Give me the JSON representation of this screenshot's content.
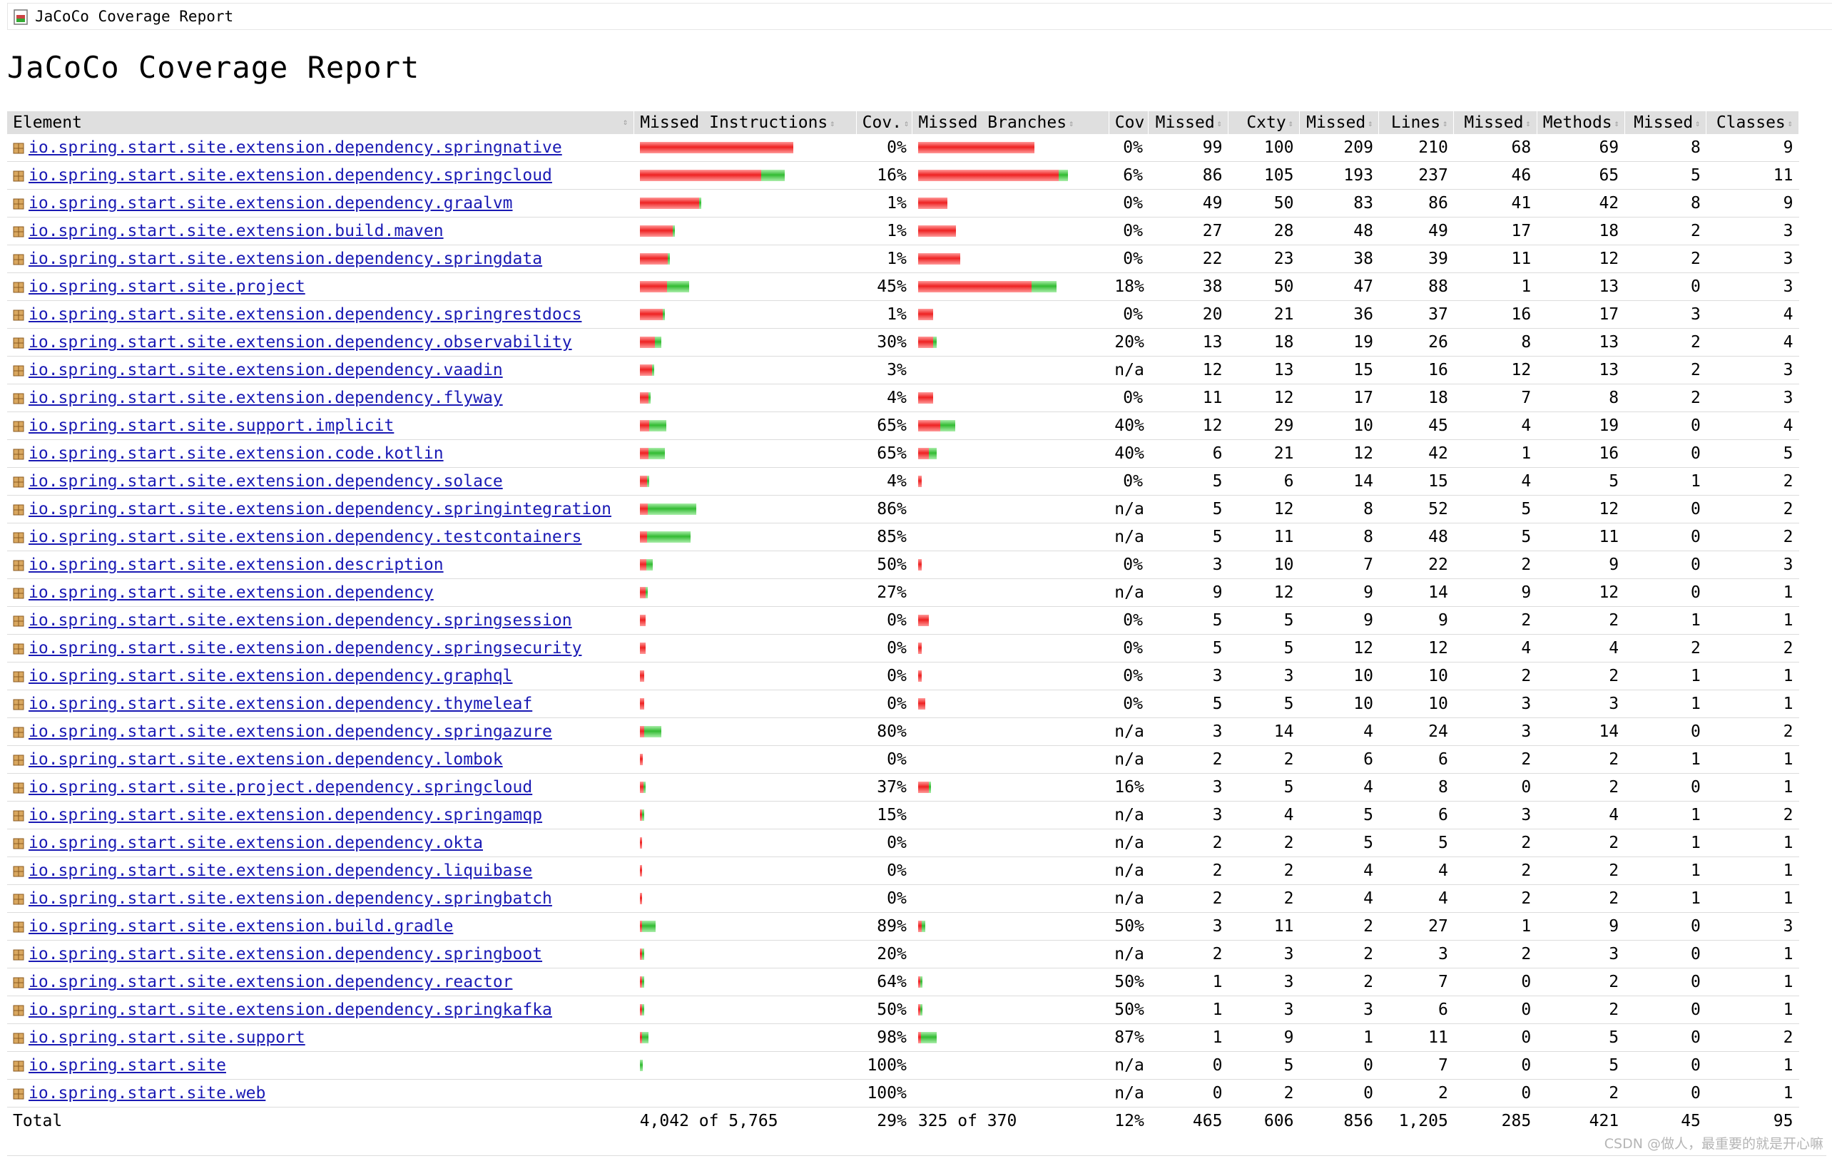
{
  "breadcrumb": {
    "label": "JaCoCo Coverage Report"
  },
  "page_title": "JaCoCo Coverage Report",
  "columns": {
    "element": "Element",
    "missed_instructions": "Missed Instructions",
    "cov1": "Cov.",
    "missed_branches": "Missed Branches",
    "cov2": "Cov.",
    "missed_cxty": "Missed",
    "cxty": "Cxty",
    "missed_lines": "Missed",
    "lines": "Lines",
    "missed_methods": "Missed",
    "methods": "Methods",
    "missed_classes": "Missed",
    "classes": "Classes"
  },
  "rows": [
    {
      "name": "io.spring.start.site.extension.dependency.springnative",
      "instr_missed": 430,
      "instr_covered": 0,
      "instr_cov": "0%",
      "br_missed": 220,
      "br_covered": 0,
      "br_cov": "0%",
      "mcx": "99",
      "cx": "100",
      "ml": "209",
      "l": "210",
      "mm": "68",
      "m": "69",
      "mc": "8",
      "c": "9"
    },
    {
      "name": "io.spring.start.site.extension.dependency.springcloud",
      "instr_missed": 341,
      "instr_covered": 65,
      "instr_cov": "16%",
      "br_missed": 267,
      "br_covered": 17,
      "br_cov": "6%",
      "mcx": "86",
      "cx": "105",
      "ml": "193",
      "l": "237",
      "mm": "46",
      "m": "65",
      "mc": "5",
      "c": "11"
    },
    {
      "name": "io.spring.start.site.extension.dependency.graalvm",
      "instr_missed": 167,
      "instr_covered": 2,
      "instr_cov": "1%",
      "br_missed": 56,
      "br_covered": 0,
      "br_cov": "0%",
      "mcx": "49",
      "cx": "50",
      "ml": "83",
      "l": "86",
      "mm": "41",
      "m": "42",
      "mc": "8",
      "c": "9"
    },
    {
      "name": "io.spring.start.site.extension.build.maven",
      "instr_missed": 92,
      "instr_covered": 1,
      "instr_cov": "1%",
      "br_missed": 72,
      "br_covered": 0,
      "br_cov": "0%",
      "mcx": "27",
      "cx": "28",
      "ml": "48",
      "l": "49",
      "mm": "17",
      "m": "18",
      "mc": "2",
      "c": "3"
    },
    {
      "name": "io.spring.start.site.extension.dependency.springdata",
      "instr_missed": 79,
      "instr_covered": 1,
      "instr_cov": "1%",
      "br_missed": 80,
      "br_covered": 0,
      "br_cov": "0%",
      "mcx": "22",
      "cx": "23",
      "ml": "38",
      "l": "39",
      "mm": "11",
      "m": "12",
      "mc": "2",
      "c": "3"
    },
    {
      "name": "io.spring.start.site.project",
      "instr_missed": 76,
      "instr_covered": 62,
      "instr_cov": "45%",
      "br_missed": 215,
      "br_covered": 48,
      "br_cov": "18%",
      "mcx": "38",
      "cx": "50",
      "ml": "47",
      "l": "88",
      "mm": "1",
      "m": "13",
      "mc": "0",
      "c": "3"
    },
    {
      "name": "io.spring.start.site.extension.dependency.springrestdocs",
      "instr_missed": 65,
      "instr_covered": 1,
      "instr_cov": "1%",
      "br_missed": 28,
      "br_covered": 0,
      "br_cov": "0%",
      "mcx": "20",
      "cx": "21",
      "ml": "36",
      "l": "37",
      "mm": "16",
      "m": "17",
      "mc": "3",
      "c": "4"
    },
    {
      "name": "io.spring.start.site.extension.dependency.observability",
      "instr_missed": 42,
      "instr_covered": 18,
      "instr_cov": "30%",
      "br_missed": 28,
      "br_covered": 7,
      "br_cov": "20%",
      "mcx": "13",
      "cx": "18",
      "ml": "19",
      "l": "26",
      "mm": "8",
      "m": "13",
      "mc": "2",
      "c": "4"
    },
    {
      "name": "io.spring.start.site.extension.dependency.vaadin",
      "instr_missed": 34,
      "instr_covered": 1,
      "instr_cov": "3%",
      "br_missed": 0,
      "br_covered": 0,
      "br_cov": "n/a",
      "mcx": "12",
      "cx": "13",
      "ml": "15",
      "l": "16",
      "mm": "12",
      "m": "13",
      "mc": "2",
      "c": "3"
    },
    {
      "name": "io.spring.start.site.extension.dependency.flyway",
      "instr_missed": 25,
      "instr_covered": 1,
      "instr_cov": "4%",
      "br_missed": 28,
      "br_covered": 0,
      "br_cov": "0%",
      "mcx": "11",
      "cx": "12",
      "ml": "17",
      "l": "18",
      "mm": "7",
      "m": "8",
      "mc": "2",
      "c": "3"
    },
    {
      "name": "io.spring.start.site.support.implicit",
      "instr_missed": 26,
      "instr_covered": 48,
      "instr_cov": "65%",
      "br_missed": 42,
      "br_covered": 28,
      "br_cov": "40%",
      "mcx": "12",
      "cx": "29",
      "ml": "10",
      "l": "45",
      "mm": "4",
      "m": "19",
      "mc": "0",
      "c": "4"
    },
    {
      "name": "io.spring.start.site.extension.code.kotlin",
      "instr_missed": 25,
      "instr_covered": 46,
      "instr_cov": "65%",
      "br_missed": 21,
      "br_covered": 14,
      "br_cov": "40%",
      "mcx": "6",
      "cx": "21",
      "ml": "12",
      "l": "42",
      "mm": "1",
      "m": "16",
      "mc": "0",
      "c": "5"
    },
    {
      "name": "io.spring.start.site.extension.dependency.solace",
      "instr_missed": 21,
      "instr_covered": 1,
      "instr_cov": "4%",
      "br_missed": 7,
      "br_covered": 0,
      "br_cov": "0%",
      "mcx": "5",
      "cx": "6",
      "ml": "14",
      "l": "15",
      "mm": "4",
      "m": "5",
      "mc": "1",
      "c": "2"
    },
    {
      "name": "io.spring.start.site.extension.dependency.springintegration",
      "instr_missed": 22,
      "instr_covered": 136,
      "instr_cov": "86%",
      "br_missed": 0,
      "br_covered": 0,
      "br_cov": "n/a",
      "mcx": "5",
      "cx": "12",
      "ml": "8",
      "l": "52",
      "mm": "5",
      "m": "12",
      "mc": "0",
      "c": "2"
    },
    {
      "name": "io.spring.start.site.extension.dependency.testcontainers",
      "instr_missed": 21,
      "instr_covered": 122,
      "instr_cov": "85%",
      "br_missed": 0,
      "br_covered": 0,
      "br_cov": "n/a",
      "mcx": "5",
      "cx": "11",
      "ml": "8",
      "l": "48",
      "mm": "5",
      "m": "11",
      "mc": "0",
      "c": "2"
    },
    {
      "name": "io.spring.start.site.extension.description",
      "instr_missed": 18,
      "instr_covered": 18,
      "instr_cov": "50%",
      "br_missed": 7,
      "br_covered": 0,
      "br_cov": "0%",
      "mcx": "3",
      "cx": "10",
      "ml": "7",
      "l": "22",
      "mm": "2",
      "m": "9",
      "mc": "0",
      "c": "3"
    },
    {
      "name": "io.spring.start.site.extension.dependency",
      "instr_missed": 16,
      "instr_covered": 6,
      "instr_cov": "27%",
      "br_missed": 0,
      "br_covered": 0,
      "br_cov": "n/a",
      "mcx": "9",
      "cx": "12",
      "ml": "9",
      "l": "14",
      "mm": "9",
      "m": "12",
      "mc": "0",
      "c": "1"
    },
    {
      "name": "io.spring.start.site.extension.dependency.springsession",
      "instr_missed": 16,
      "instr_covered": 0,
      "instr_cov": "0%",
      "br_missed": 21,
      "br_covered": 0,
      "br_cov": "0%",
      "mcx": "5",
      "cx": "5",
      "ml": "9",
      "l": "9",
      "mm": "2",
      "m": "2",
      "mc": "1",
      "c": "1"
    },
    {
      "name": "io.spring.start.site.extension.dependency.springsecurity",
      "instr_missed": 16,
      "instr_covered": 0,
      "instr_cov": "0%",
      "br_missed": 7,
      "br_covered": 0,
      "br_cov": "0%",
      "mcx": "5",
      "cx": "5",
      "ml": "12",
      "l": "12",
      "mm": "4",
      "m": "4",
      "mc": "2",
      "c": "2"
    },
    {
      "name": "io.spring.start.site.extension.dependency.graphql",
      "instr_missed": 12,
      "instr_covered": 0,
      "instr_cov": "0%",
      "br_missed": 7,
      "br_covered": 0,
      "br_cov": "0%",
      "mcx": "3",
      "cx": "3",
      "ml": "10",
      "l": "10",
      "mm": "2",
      "m": "2",
      "mc": "1",
      "c": "1"
    },
    {
      "name": "io.spring.start.site.extension.dependency.thymeleaf",
      "instr_missed": 12,
      "instr_covered": 0,
      "instr_cov": "0%",
      "br_missed": 14,
      "br_covered": 0,
      "br_cov": "0%",
      "mcx": "5",
      "cx": "5",
      "ml": "10",
      "l": "10",
      "mm": "3",
      "m": "3",
      "mc": "1",
      "c": "1"
    },
    {
      "name": "io.spring.start.site.extension.dependency.springazure",
      "instr_missed": 12,
      "instr_covered": 48,
      "instr_cov": "80%",
      "br_missed": 0,
      "br_covered": 0,
      "br_cov": "n/a",
      "mcx": "3",
      "cx": "14",
      "ml": "4",
      "l": "24",
      "mm": "3",
      "m": "14",
      "mc": "0",
      "c": "2"
    },
    {
      "name": "io.spring.start.site.extension.dependency.lombok",
      "instr_missed": 8,
      "instr_covered": 0,
      "instr_cov": "0%",
      "br_missed": 0,
      "br_covered": 0,
      "br_cov": "n/a",
      "mcx": "2",
      "cx": "2",
      "ml": "6",
      "l": "6",
      "mm": "2",
      "m": "2",
      "mc": "1",
      "c": "1"
    },
    {
      "name": "io.spring.start.site.project.dependency.springcloud",
      "instr_missed": 10,
      "instr_covered": 6,
      "instr_cov": "37%",
      "br_missed": 21,
      "br_covered": 4,
      "br_cov": "16%",
      "mcx": "3",
      "cx": "5",
      "ml": "4",
      "l": "8",
      "mm": "0",
      "m": "2",
      "mc": "0",
      "c": "1"
    },
    {
      "name": "io.spring.start.site.extension.dependency.springamqp",
      "instr_missed": 7,
      "instr_covered": 1,
      "instr_cov": "15%",
      "br_missed": 0,
      "br_covered": 0,
      "br_cov": "n/a",
      "mcx": "3",
      "cx": "4",
      "ml": "5",
      "l": "6",
      "mm": "3",
      "m": "4",
      "mc": "1",
      "c": "2"
    },
    {
      "name": "io.spring.start.site.extension.dependency.okta",
      "instr_missed": 7,
      "instr_covered": 0,
      "instr_cov": "0%",
      "br_missed": 0,
      "br_covered": 0,
      "br_cov": "n/a",
      "mcx": "2",
      "cx": "2",
      "ml": "5",
      "l": "5",
      "mm": "2",
      "m": "2",
      "mc": "1",
      "c": "1"
    },
    {
      "name": "io.spring.start.site.extension.dependency.liquibase",
      "instr_missed": 7,
      "instr_covered": 0,
      "instr_cov": "0%",
      "br_missed": 0,
      "br_covered": 0,
      "br_cov": "n/a",
      "mcx": "2",
      "cx": "2",
      "ml": "4",
      "l": "4",
      "mm": "2",
      "m": "2",
      "mc": "1",
      "c": "1"
    },
    {
      "name": "io.spring.start.site.extension.dependency.springbatch",
      "instr_missed": 7,
      "instr_covered": 0,
      "instr_cov": "0%",
      "br_missed": 0,
      "br_covered": 0,
      "br_cov": "n/a",
      "mcx": "2",
      "cx": "2",
      "ml": "4",
      "l": "4",
      "mm": "2",
      "m": "2",
      "mc": "1",
      "c": "1"
    },
    {
      "name": "io.spring.start.site.extension.build.gradle",
      "instr_missed": 5,
      "instr_covered": 38,
      "instr_cov": "89%",
      "br_missed": 7,
      "br_covered": 7,
      "br_cov": "50%",
      "mcx": "3",
      "cx": "11",
      "ml": "2",
      "l": "27",
      "mm": "1",
      "m": "9",
      "mc": "0",
      "c": "3"
    },
    {
      "name": "io.spring.start.site.extension.dependency.springboot",
      "instr_missed": 6,
      "instr_covered": 1,
      "instr_cov": "20%",
      "br_missed": 0,
      "br_covered": 0,
      "br_cov": "n/a",
      "mcx": "2",
      "cx": "3",
      "ml": "2",
      "l": "3",
      "mm": "2",
      "m": "3",
      "mc": "0",
      "c": "1"
    },
    {
      "name": "io.spring.start.site.extension.dependency.reactor",
      "instr_missed": 3,
      "instr_covered": 6,
      "instr_cov": "64%",
      "br_missed": 2,
      "br_covered": 2,
      "br_cov": "50%",
      "mcx": "1",
      "cx": "3",
      "ml": "2",
      "l": "7",
      "mm": "0",
      "m": "2",
      "mc": "0",
      "c": "1"
    },
    {
      "name": "io.spring.start.site.extension.dependency.springkafka",
      "instr_missed": 4,
      "instr_covered": 4,
      "instr_cov": "50%",
      "br_missed": 2,
      "br_covered": 2,
      "br_cov": "50%",
      "mcx": "1",
      "cx": "3",
      "ml": "3",
      "l": "6",
      "mm": "0",
      "m": "2",
      "mc": "0",
      "c": "1"
    },
    {
      "name": "io.spring.start.site.support",
      "instr_missed": 1,
      "instr_covered": 19,
      "instr_cov": "98%",
      "br_missed": 5,
      "br_covered": 30,
      "br_cov": "87%",
      "mcx": "1",
      "cx": "9",
      "ml": "1",
      "l": "11",
      "mm": "0",
      "m": "5",
      "mc": "0",
      "c": "2"
    },
    {
      "name": "io.spring.start.site",
      "instr_missed": 0,
      "instr_covered": 9,
      "instr_cov": "100%",
      "br_missed": 0,
      "br_covered": 0,
      "br_cov": "n/a",
      "mcx": "0",
      "cx": "5",
      "ml": "0",
      "l": "7",
      "mm": "0",
      "m": "5",
      "mc": "0",
      "c": "1"
    },
    {
      "name": "io.spring.start.site.web",
      "instr_missed": 0,
      "instr_covered": 0,
      "instr_cov": "100%",
      "br_missed": 0,
      "br_covered": 0,
      "br_cov": "n/a",
      "mcx": "0",
      "cx": "2",
      "ml": "0",
      "l": "2",
      "mm": "0",
      "m": "2",
      "mc": "0",
      "c": "1"
    }
  ],
  "total": {
    "label": "Total",
    "instr": "4,042 of 5,765",
    "instr_cov": "29%",
    "br": "325 of 370",
    "br_cov": "12%",
    "mcx": "465",
    "cx": "606",
    "ml": "856",
    "l": "1,205",
    "mm": "285",
    "m": "421",
    "mc": "45",
    "c": "95"
  },
  "bar_scale": {
    "instr_max": 430,
    "br_max": 284
  },
  "colors": {
    "missed": "#ee2222",
    "covered": "#33bb33",
    "link": "#1a1ab4",
    "header_bg": "#dfdfdf"
  },
  "watermark": "CSDN @做人，最重要的就是开心嘛"
}
